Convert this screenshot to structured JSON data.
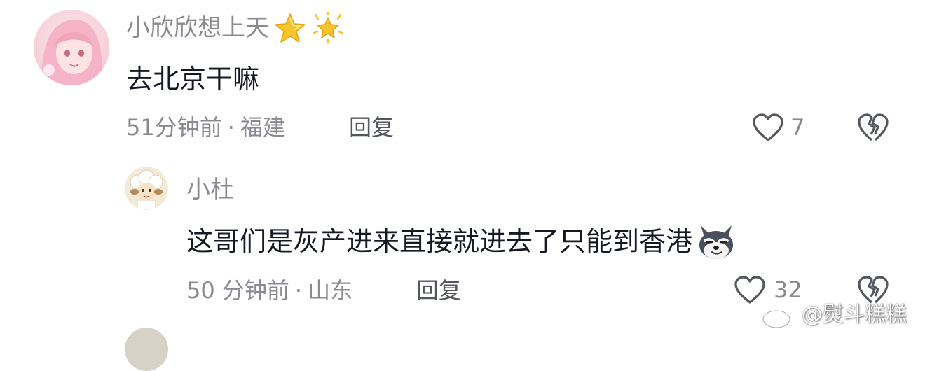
{
  "comments": [
    {
      "username": "小欣欣想上天",
      "badge_icons": [
        "star-icon",
        "sparkle-star-icon"
      ],
      "text": "去北京干嘛",
      "time": "51分钟前",
      "separator": "·",
      "location": "福建",
      "reply_label": "回复",
      "like_count": "7",
      "replies": [
        {
          "username": "小杜",
          "text": "这哥们是灰产进来直接就进去了只能到香港",
          "emoji_icon": "husky-dog-emoji-icon",
          "time": "50 分钟前",
          "separator": "·",
          "location": "山东",
          "reply_label": "回复",
          "like_count": "32"
        }
      ]
    }
  ],
  "watermark": {
    "text": "@熨斗糕糕",
    "icon": "weibo-logo-icon"
  },
  "colors": {
    "text_primary": "#161823",
    "text_secondary": "#8a8b91",
    "reply_text": "#55575f",
    "star_gold": "#f6c42b"
  }
}
